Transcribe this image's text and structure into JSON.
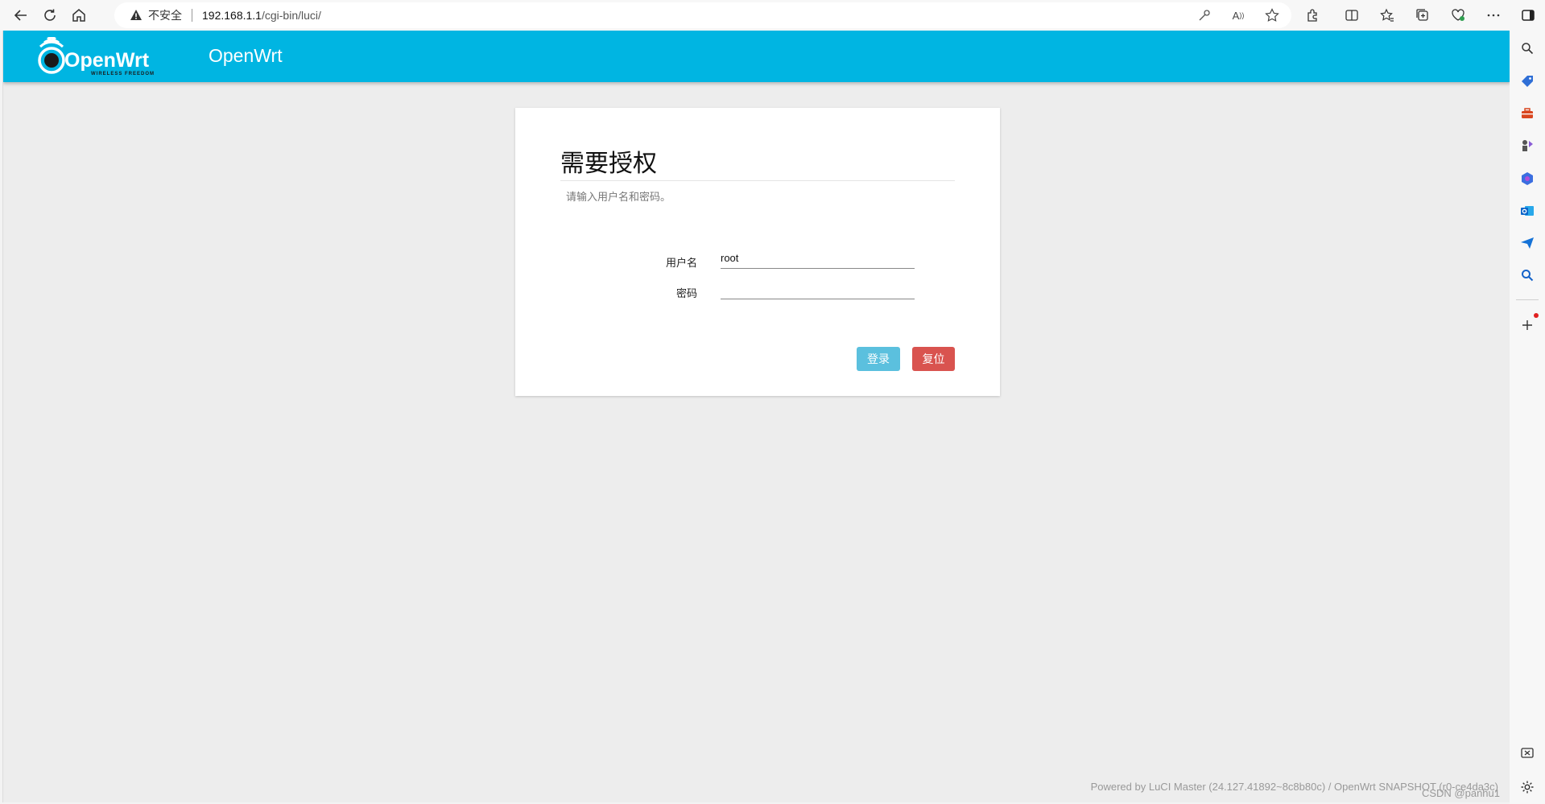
{
  "browser": {
    "insecure_label": "不安全",
    "url_host": "192.168.1.1",
    "url_path": "/cgi-bin/luci/"
  },
  "header": {
    "brand": "OpenWrt",
    "logo_text": "OpenWrt",
    "logo_tagline": "WIRELESS FREEDOM"
  },
  "login": {
    "title": "需要授权",
    "description": "请输入用户名和密码。",
    "username_label": "用户名",
    "username_value": "root",
    "password_label": "密码",
    "password_value": "",
    "login_button": "登录",
    "reset_button": "复位"
  },
  "footer": {
    "text": "Powered by LuCI Master (24.127.41892~8c8b80c) / OpenWrt SNAPSHOT (r0-ce4da3c)"
  },
  "watermark": "CSDN @panhu1",
  "icons": {
    "back": "back-arrow-icon",
    "refresh": "refresh-icon",
    "home": "home-icon",
    "warning": "warning-icon",
    "accent": "#00b5e2",
    "login_color": "#5bc0de",
    "reset_color": "#d9534f"
  }
}
